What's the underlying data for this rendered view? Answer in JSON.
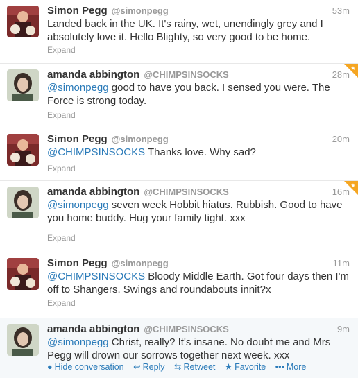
{
  "tweets": [
    {
      "name": "Simon Pegg",
      "handle": "@simonpegg",
      "time": "53m",
      "text": "Landed back in the UK. It's rainy, wet, unendingly grey and I absolutely love it. Hello Blighty, so very good to be home.",
      "expand": "Expand",
      "favorited": false
    },
    {
      "name": "amanda abbington",
      "handle": "@CHIMPSINSOCKS",
      "time": "28m",
      "mention": "@simonpegg",
      "text": " good to have you back. I sensed you were. The Force is strong today.",
      "expand": "Expand",
      "favorited": true
    },
    {
      "name": "Simon Pegg",
      "handle": "@simonpegg",
      "time": "20m",
      "mention": "@CHIMPSINSOCKS",
      "text": " Thanks love. Why sad?",
      "expand": "Expand",
      "favorited": false
    },
    {
      "name": "amanda abbington",
      "handle": "@CHIMPSINSOCKS",
      "time": "16m",
      "mention": "@simonpegg",
      "text": " seven week Hobbit hiatus. Rubbish. Good to have you home buddy. Hug your family tight. xxx",
      "expand": "Expand",
      "favorited": true
    },
    {
      "name": "Simon Pegg",
      "handle": "@simonpegg",
      "time": "11m",
      "mention": "@CHIMPSINSOCKS",
      "text": " Bloody Middle Earth. Got four days then I'm off to Shangers. Swings and roundabouts innit?x",
      "expand": "Expand",
      "favorited": false
    },
    {
      "name": "amanda abbington",
      "handle": "@CHIMPSINSOCKS",
      "time": "9m",
      "mention": "@simonpegg",
      "text": " Christ, really? It's insane. No doubt me and Mrs Pegg will drown our sorrows together next week. xxx",
      "favorited": false
    }
  ],
  "actions": {
    "hide_conversation": "Hide conversation",
    "reply": "Reply",
    "retweet": "Retweet",
    "favorite": "Favorite",
    "more": "More"
  },
  "colors": {
    "link": "#2b7bb9",
    "muted": "#999999",
    "favorite_star": "#f5a623"
  }
}
